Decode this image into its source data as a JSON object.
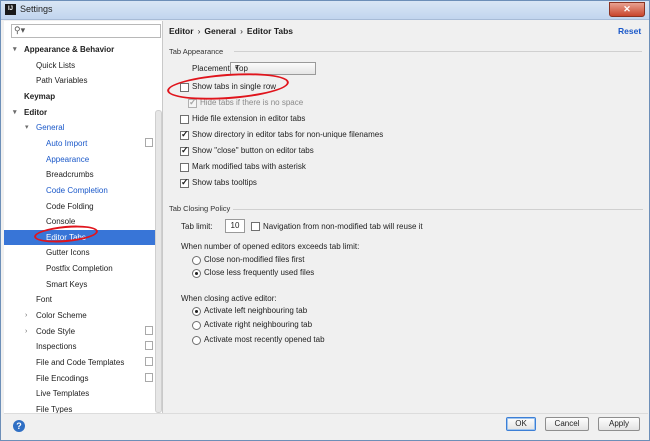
{
  "window": {
    "title": "Settings",
    "app_icon": "intellij-icon",
    "close_glyph": "✕"
  },
  "search": {
    "value": "",
    "icon": "search-icon"
  },
  "tree": [
    {
      "label": "Appearance & Behavior",
      "bold": true,
      "expanded": true
    },
    {
      "label": "Quick Lists"
    },
    {
      "label": "Path Variables"
    },
    {
      "label": "Keymap",
      "bold": true
    },
    {
      "label": "Editor",
      "bold": true,
      "expanded": true
    },
    {
      "label": "General",
      "expanded": true,
      "blue": true
    },
    {
      "label": "Auto Import",
      "blue": true,
      "copy_icon": true
    },
    {
      "label": "Appearance",
      "blue": true
    },
    {
      "label": "Breadcrumbs"
    },
    {
      "label": "Code Completion",
      "blue": true
    },
    {
      "label": "Code Folding"
    },
    {
      "label": "Console"
    },
    {
      "label": "Editor Tabs",
      "selected": true
    },
    {
      "label": "Gutter Icons"
    },
    {
      "label": "Postfix Completion"
    },
    {
      "label": "Smart Keys"
    },
    {
      "label": "Font"
    },
    {
      "label": "Color Scheme",
      "collapsed": true
    },
    {
      "label": "Code Style",
      "collapsed": true,
      "copy_icon": true
    },
    {
      "label": "Inspections",
      "copy_icon": true
    },
    {
      "label": "File and Code Templates",
      "copy_icon": true
    },
    {
      "label": "File Encodings",
      "copy_icon": true
    },
    {
      "label": "Live Templates"
    },
    {
      "label": "File Types"
    }
  ],
  "breadcrumb": {
    "items": [
      "Editor",
      "General",
      "Editor Tabs"
    ],
    "separator": "›"
  },
  "reset_label": "Reset",
  "tab_appearance": {
    "title": "Tab Appearance",
    "placement_label": "Placement:",
    "placement_value": "Top",
    "options": [
      {
        "label": "Show tabs in single row",
        "checked": false
      },
      {
        "label": "Hide tabs if there is no space",
        "checked": true,
        "disabled": true
      },
      {
        "label": "Hide file extension in editor tabs",
        "checked": false
      },
      {
        "label": "Show directory in editor tabs for non-unique filenames",
        "checked": true
      },
      {
        "label": "Show \"close\" button on editor tabs",
        "checked": true
      },
      {
        "label": "Mark modified tabs with asterisk",
        "checked": false
      },
      {
        "label": "Show tabs tooltips",
        "checked": true
      }
    ]
  },
  "tab_closing": {
    "title": "Tab Closing Policy",
    "tab_limit_label": "Tab limit:",
    "tab_limit_value": "10",
    "nav_label": "Navigation from non-modified tab will reuse it",
    "nav_checked": false,
    "exceeds_label": "When number of opened editors exceeds tab limit:",
    "exceeds_options": [
      {
        "label": "Close non-modified files first",
        "selected": false
      },
      {
        "label": "Close less frequently used files",
        "selected": true
      }
    ],
    "closing_label": "When closing active editor:",
    "closing_options": [
      {
        "label": "Activate left neighbouring tab",
        "selected": true
      },
      {
        "label": "Activate right neighbouring tab",
        "selected": false
      },
      {
        "label": "Activate most recently opened tab",
        "selected": false
      }
    ]
  },
  "footer": {
    "help_glyph": "?",
    "ok_label": "OK",
    "cancel_label": "Cancel",
    "apply_label": "Apply"
  },
  "colors": {
    "selection": "#3875d7",
    "link": "#1a58c9",
    "annotation": "#e0141c"
  }
}
